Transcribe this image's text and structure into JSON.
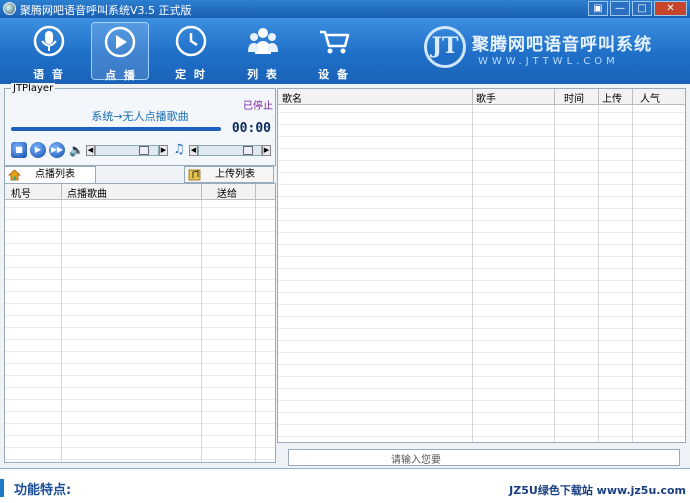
{
  "window": {
    "title": "聚腾网吧语音呼叫系统V3.5 正式版",
    "buttons": [
      "▣",
      "—",
      "□",
      "✕"
    ]
  },
  "toolbar": {
    "items": [
      {
        "label": "语 音",
        "icon": "microphone-icon"
      },
      {
        "label": "点 播",
        "icon": "play-icon",
        "active": true
      },
      {
        "label": "定 时",
        "icon": "clock-icon"
      },
      {
        "label": "列 表",
        "icon": "users-icon"
      },
      {
        "label": "设 备",
        "icon": "cart-icon"
      }
    ],
    "brand_name": "聚腾网吧语音呼叫系统",
    "brand_url": "WWW.JTTWL.COM",
    "brand_logo": "JT"
  },
  "player": {
    "caption": "JTPlayer",
    "state": "已停止",
    "song": "系统→无人点播歌曲",
    "time": "00:00",
    "progress": 1.0,
    "volume": 0.82,
    "balance": 0.85
  },
  "left_tabs": [
    "点播列表",
    "上传列表"
  ],
  "left_columns": [
    "机号",
    "点播歌曲",
    "送给"
  ],
  "right_columns": [
    "歌名",
    "歌手",
    "时间",
    "上传",
    "人气"
  ],
  "input": {
    "placeholder": "请输入您要"
  },
  "footer": {
    "features": "功能特点:",
    "site": "JZ5U绿色下载站 www.jz5u.com"
  },
  "colors": {
    "titlebar": "#1a5fb0",
    "toolbar": "#1f6fc8",
    "accent": "#1c60c0",
    "state": "#7b1fa2"
  }
}
